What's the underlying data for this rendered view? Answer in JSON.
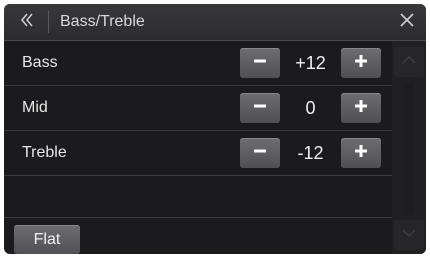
{
  "header": {
    "back_icon": "double-chevron-left-icon",
    "title": "Bass/Treble",
    "close_icon": "close-icon"
  },
  "rows": [
    {
      "label": "Bass",
      "value": "+12",
      "minus_icon": "minus-icon",
      "plus_icon": "plus-icon"
    },
    {
      "label": "Mid",
      "value": "0",
      "minus_icon": "minus-icon",
      "plus_icon": "plus-icon"
    },
    {
      "label": "Treble",
      "value": "-12",
      "minus_icon": "minus-icon",
      "plus_icon": "plus-icon"
    }
  ],
  "footer": {
    "flat_label": "Flat"
  },
  "scroll": {
    "up_icon": "chevron-up-icon",
    "down_icon": "chevron-down-icon"
  },
  "colors": {
    "background": "#1b1b1d",
    "button": "#5f5f64",
    "text": "#e6e6e6"
  }
}
